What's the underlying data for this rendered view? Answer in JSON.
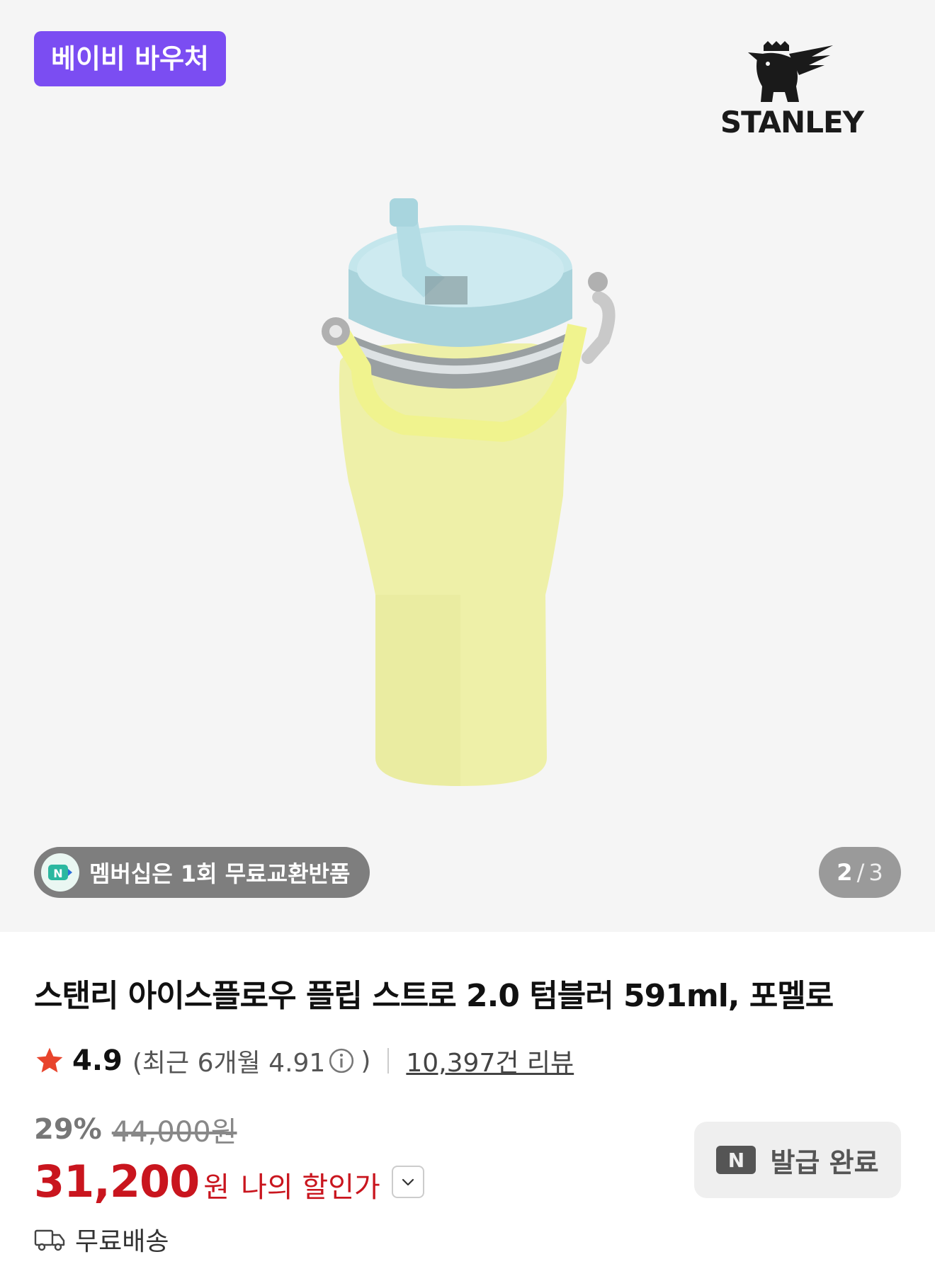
{
  "hero": {
    "voucher_badge": "베이비 바우처",
    "brand": "STANLEY",
    "membership_badge": "멤버십은 1회 무료교환반품",
    "membership_icon_letter": "N",
    "page_indicator": {
      "current": "2",
      "separator": "/",
      "total": "3"
    }
  },
  "product": {
    "title": "스탠리 아이스플로우 플립 스트로 2.0 텀블러 591ml, 포멜로",
    "rating": "4.9",
    "recent_rating_prefix": "(최근 6개월 4.91",
    "recent_rating_suffix": ")",
    "review_count": "10,397건 리뷰",
    "discount_rate": "29%",
    "original_price": "44,000원",
    "final_price": "31,200",
    "currency": "원",
    "my_price_label": "나의 할인가",
    "coupon_icon_letter": "N",
    "coupon_button": "발급 완료",
    "shipping": "무료배송"
  },
  "colors": {
    "voucher": "#7b4df2",
    "price_red": "#c9151e",
    "star": "#e8442c",
    "tumbler_body": "#eef0a8",
    "lid": "#b8dfe6"
  },
  "icons": [
    "bear-logo-icon",
    "n-membership-icon",
    "star-icon",
    "info-icon",
    "chevron-down-icon",
    "n-coupon-icon",
    "truck-icon"
  ]
}
